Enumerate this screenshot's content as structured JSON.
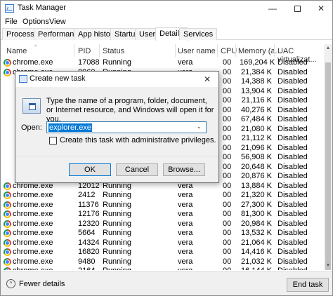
{
  "window": {
    "title": "Task Manager",
    "minimize": "—",
    "close": "✕"
  },
  "menu": [
    "File",
    "Options",
    "View"
  ],
  "tabs": [
    "Processes",
    "Performance",
    "App history",
    "Startup",
    "Users",
    "Details",
    "Services"
  ],
  "active_tab": "Details",
  "columns": {
    "name": "Name",
    "pid": "PID",
    "status": "Status",
    "user": "User name",
    "cpu": "CPU",
    "memory": "Memory (a...",
    "uac": "UAC virtualizat..."
  },
  "rows": [
    {
      "name": "chrome.exe",
      "pid": "17088",
      "status": "Running",
      "user": "vera",
      "cpu": "00",
      "mem": "169,204 K",
      "uac": "Disabled"
    },
    {
      "name": "chrome.exe",
      "pid": "8960",
      "status": "Running",
      "user": "vera",
      "cpu": "00",
      "mem": "21,384 K",
      "uac": "Disabled"
    },
    {
      "name": "",
      "pid": "",
      "status": "",
      "user": "",
      "cpu": "00",
      "mem": "14,388 K",
      "uac": "Disabled"
    },
    {
      "name": "",
      "pid": "",
      "status": "",
      "user": "",
      "cpu": "00",
      "mem": "13,904 K",
      "uac": "Disabled"
    },
    {
      "name": "",
      "pid": "",
      "status": "",
      "user": "",
      "cpu": "00",
      "mem": "21,116 K",
      "uac": "Disabled"
    },
    {
      "name": "",
      "pid": "",
      "status": "",
      "user": "",
      "cpu": "00",
      "mem": "40,276 K",
      "uac": "Disabled"
    },
    {
      "name": "",
      "pid": "",
      "status": "",
      "user": "",
      "cpu": "00",
      "mem": "67,484 K",
      "uac": "Disabled"
    },
    {
      "name": "",
      "pid": "",
      "status": "",
      "user": "",
      "cpu": "00",
      "mem": "21,080 K",
      "uac": "Disabled"
    },
    {
      "name": "",
      "pid": "",
      "status": "",
      "user": "",
      "cpu": "00",
      "mem": "21,112 K",
      "uac": "Disabled"
    },
    {
      "name": "",
      "pid": "",
      "status": "",
      "user": "",
      "cpu": "00",
      "mem": "21,096 K",
      "uac": "Disabled"
    },
    {
      "name": "",
      "pid": "",
      "status": "",
      "user": "",
      "cpu": "00",
      "mem": "56,908 K",
      "uac": "Disabled"
    },
    {
      "name": "",
      "pid": "",
      "status": "",
      "user": "",
      "cpu": "00",
      "mem": "20,648 K",
      "uac": "Disabled"
    },
    {
      "name": "",
      "pid": "",
      "status": "",
      "user": "",
      "cpu": "00",
      "mem": "20,876 K",
      "uac": "Disabled"
    },
    {
      "name": "chrome.exe",
      "pid": "12012",
      "status": "Running",
      "user": "vera",
      "cpu": "00",
      "mem": "13,884 K",
      "uac": "Disabled"
    },
    {
      "name": "chrome.exe",
      "pid": "2412",
      "status": "Running",
      "user": "vera",
      "cpu": "00",
      "mem": "21,320 K",
      "uac": "Disabled"
    },
    {
      "name": "chrome.exe",
      "pid": "11376",
      "status": "Running",
      "user": "vera",
      "cpu": "00",
      "mem": "27,300 K",
      "uac": "Disabled"
    },
    {
      "name": "chrome.exe",
      "pid": "12176",
      "status": "Running",
      "user": "vera",
      "cpu": "00",
      "mem": "81,300 K",
      "uac": "Disabled"
    },
    {
      "name": "chrome.exe",
      "pid": "12320",
      "status": "Running",
      "user": "vera",
      "cpu": "00",
      "mem": "20,984 K",
      "uac": "Disabled"
    },
    {
      "name": "chrome.exe",
      "pid": "5664",
      "status": "Running",
      "user": "vera",
      "cpu": "00",
      "mem": "13,532 K",
      "uac": "Disabled"
    },
    {
      "name": "chrome.exe",
      "pid": "14324",
      "status": "Running",
      "user": "vera",
      "cpu": "00",
      "mem": "21,064 K",
      "uac": "Disabled"
    },
    {
      "name": "chrome.exe",
      "pid": "16820",
      "status": "Running",
      "user": "vera",
      "cpu": "00",
      "mem": "14,416 K",
      "uac": "Disabled"
    },
    {
      "name": "chrome.exe",
      "pid": "9480",
      "status": "Running",
      "user": "vera",
      "cpu": "00",
      "mem": "21,032 K",
      "uac": "Disabled"
    },
    {
      "name": "chrome.exe",
      "pid": "2164",
      "status": "Running",
      "user": "vera",
      "cpu": "00",
      "mem": "16,144 K",
      "uac": "Disabled"
    }
  ],
  "footer": {
    "fewer_details": "Fewer details",
    "end_task": "End task"
  },
  "dialog": {
    "title": "Create new task",
    "close": "✕",
    "message": "Type the name of a program, folder, document, or Internet resource, and Windows will open it for you.",
    "open_label": "Open:",
    "input_value": "explorer.exe",
    "checkbox_label": "Create this task with administrative privileges.",
    "ok": "OK",
    "cancel": "Cancel",
    "browse": "Browse..."
  }
}
